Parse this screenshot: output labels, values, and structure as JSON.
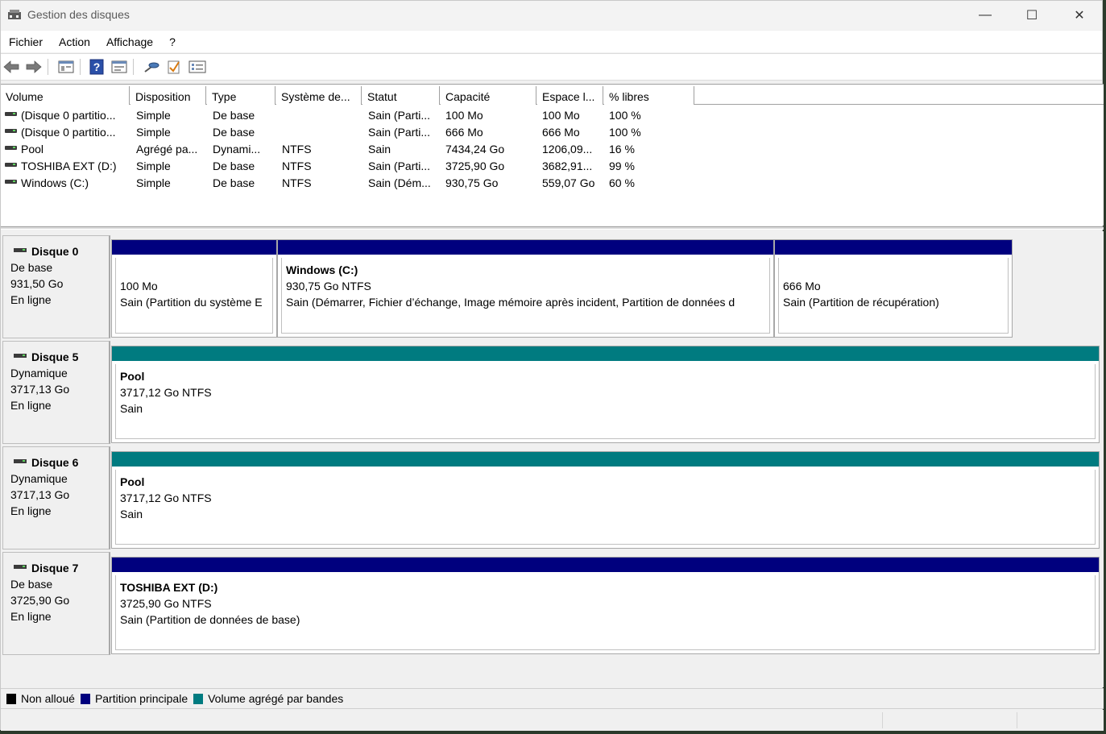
{
  "window": {
    "title": "Gestion des disques",
    "minimize_glyph": "—",
    "maximize_glyph": "☐",
    "close_glyph": "✕"
  },
  "menu": [
    "Fichier",
    "Action",
    "Affichage",
    "?"
  ],
  "toolbar": {
    "icons": [
      "back-icon",
      "forward-icon",
      "properties-icon",
      "help-icon",
      "view-icon",
      "connect-icon",
      "check-icon",
      "settings-icon"
    ]
  },
  "volume_list": {
    "columns": [
      "Volume",
      "Disposition",
      "Type",
      "Système de...",
      "Statut",
      "Capacité",
      "Espace l...",
      "% libres"
    ],
    "rows": [
      [
        "(Disque 0 partitio...",
        "Simple",
        "De base",
        "",
        "Sain (Parti...",
        "100 Mo",
        "100 Mo",
        "100 %"
      ],
      [
        "(Disque 0 partitio...",
        "Simple",
        "De base",
        "",
        "Sain (Parti...",
        "666 Mo",
        "666 Mo",
        "100 %"
      ],
      [
        "Pool",
        "Agrégé pa...",
        "Dynami...",
        "NTFS",
        "Sain",
        "7434,24 Go",
        "1206,09...",
        "16 %"
      ],
      [
        "TOSHIBA EXT (D:)",
        "Simple",
        "De base",
        "NTFS",
        "Sain (Parti...",
        "3725,90 Go",
        "3682,91...",
        "99 %"
      ],
      [
        "Windows (C:)",
        "Simple",
        "De base",
        "NTFS",
        "Sain (Dém...",
        "930,75 Go",
        "559,07 Go",
        "60 %"
      ]
    ]
  },
  "disks": [
    {
      "name": "Disque 0",
      "type": "De base",
      "size": "931,50 Go",
      "status": "En ligne",
      "partitions": [
        {
          "title": "",
          "size": "100 Mo",
          "status": "Sain (Partition du système E",
          "color": "#00007e"
        },
        {
          "title": "Windows  (C:)",
          "size": "930,75 Go NTFS",
          "status": "Sain (Démarrer, Fichier d’échange, Image mémoire après incident, Partition de données d",
          "color": "#00007e"
        },
        {
          "title": "",
          "size": "666 Mo",
          "status": "Sain (Partition de récupération)",
          "color": "#00007e"
        }
      ]
    },
    {
      "name": "Disque 5",
      "type": "Dynamique",
      "size": "3717,13 Go",
      "status": "En ligne",
      "partitions": [
        {
          "title": "Pool",
          "size": "3717,12 Go NTFS",
          "status": "Sain",
          "color": "#007b80"
        }
      ]
    },
    {
      "name": "Disque 6",
      "type": "Dynamique",
      "size": "3717,13 Go",
      "status": "En ligne",
      "partitions": [
        {
          "title": "Pool",
          "size": "3717,12 Go NTFS",
          "status": "Sain",
          "color": "#007b80"
        }
      ]
    },
    {
      "name": "Disque 7",
      "type": "De base",
      "size": "3725,90 Go",
      "status": "En ligne",
      "partitions": [
        {
          "title": "TOSHIBA EXT  (D:)",
          "size": "3725,90 Go NTFS",
          "status": "Sain (Partition de données de base)",
          "color": "#00007e"
        }
      ]
    }
  ],
  "legend": [
    {
      "label": "Non alloué",
      "color": "#000000"
    },
    {
      "label": "Partition principale",
      "color": "#00007e"
    },
    {
      "label": "Volume agrégé par bandes",
      "color": "#007b80"
    }
  ]
}
